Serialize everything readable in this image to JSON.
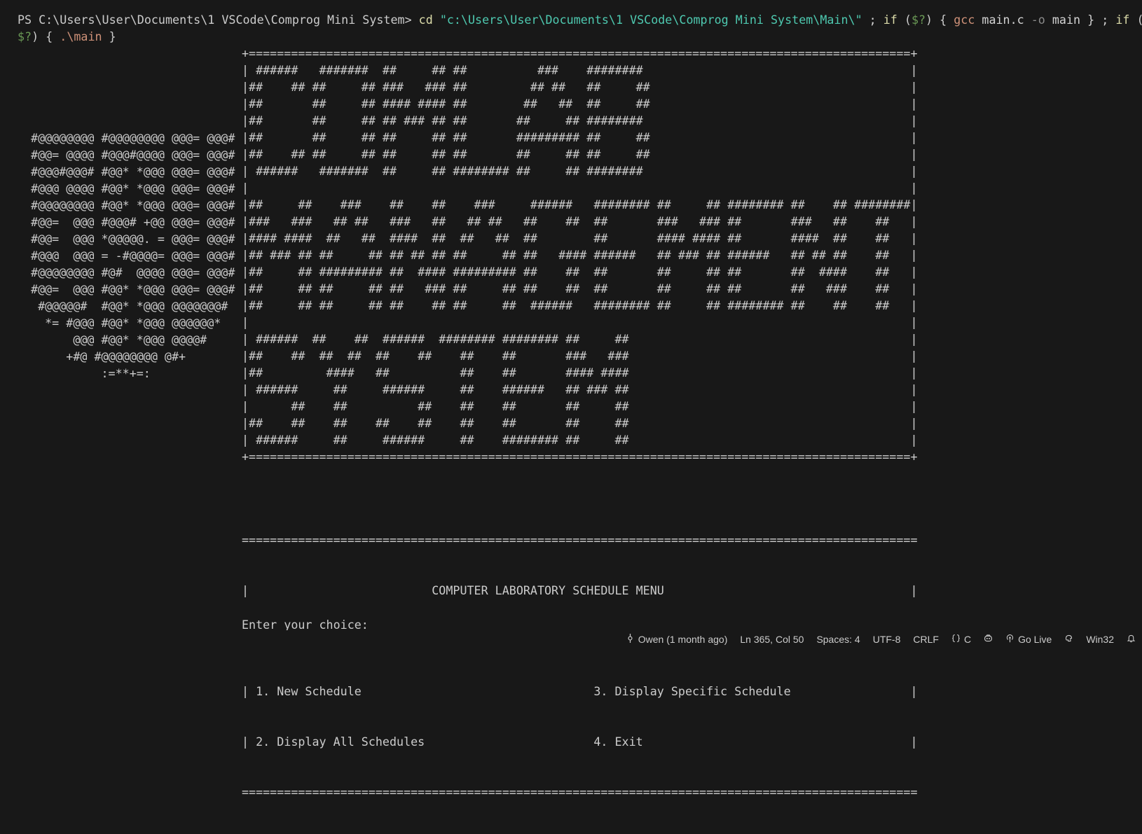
{
  "terminal": {
    "command": {
      "ps": "PS ",
      "cwd": "C:\\Users\\User\\Documents\\1 VSCode\\Comprog Mini System>",
      "cd": "cd",
      "path": "\"c:\\Users\\User\\Documents\\1 VSCode\\Comprog Mini System\\Main\\\"",
      "sep1": " ; ",
      "if1": "if",
      "open1": " (",
      "status1": "$?",
      "close1": ") { ",
      "gcc": "gcc",
      "file": " main.c ",
      "flag": "-o",
      "out": " main } ; ",
      "if2": "if",
      "open2": " (",
      "status2": "$?",
      "close2": ") { ",
      "run": ".\\main",
      "end": " }"
    },
    "logo_art": " #@@@@@@@@ #@@@@@@@@ @@@= @@@#\n #@@= @@@@ #@@@#@@@@ @@@= @@@#\n #@@@#@@@# #@@* *@@@ @@@= @@@#\n #@@@ @@@@ #@@* *@@@ @@@= @@@#\n #@@@@@@@@ #@@* *@@@ @@@= @@@#\n #@@=  @@@ #@@@# +@@ @@@= @@@#\n #@@=  @@@ *@@@@@. = @@@= @@@#\n #@@@  @@@ = -#@@@@= @@@= @@@#\n #@@@@@@@@ #@#  @@@@ @@@= @@@#\n #@@=  @@@ #@@* *@@@ @@@= @@@#\n  #@@@@@#  #@@* *@@@ @@@@@@@#\n   *= #@@@ #@@* *@@@ @@@@@@*\n       @@@ #@@* *@@@ @@@@#\n      +#@ #@@@@@@@@ @#+\n           :=**+=:",
    "banner_art": "+==============================================================================================+\n| ######   #######  ##     ## ##          ###    ########                                      |\n|##    ## ##     ## ###   ### ##         ## ##   ##     ##                                     |\n|##       ##     ## #### #### ##        ##   ##  ##     ##                                     |\n|##       ##     ## ## ### ## ##       ##     ## ########                                      |\n|##       ##     ## ##     ## ##       ######### ##     ##                                     |\n|##    ## ##     ## ##     ## ##       ##     ## ##     ##                                     |\n| ######   #######  ##     ## ######## ##     ## ########                                      |\n|                                                                                              |\n|##     ##    ###    ##    ##    ###     ######   ######## ##     ## ######## ##    ## ########|\n|###   ###   ## ##   ###   ##   ## ##   ##    ##  ##       ###   ### ##       ###   ##    ##   |\n|#### ####  ##   ##  ####  ##  ##   ##  ##        ##       #### #### ##       ####  ##    ##   |\n|## ### ## ##     ## ## ## ## ##     ## ##   #### ######   ## ### ## ######   ## ## ##    ##   |\n|##     ## ######### ##  #### ######### ##    ##  ##       ##     ## ##       ##  ####    ##   |\n|##     ## ##     ## ##   ### ##     ## ##    ##  ##       ##     ## ##       ##   ###    ##   |\n|##     ## ##     ## ##    ## ##     ##  ######   ######## ##     ## ######## ##    ##    ##   |\n|                                                                                              |\n| ######  ##    ##  ######  ######## ######## ##     ##                                        |\n|##    ##  ##  ##  ##    ##    ##    ##       ###   ###                                        |\n|##         ####   ##          ##    ##       #### ####                                        |\n| ######     ##     ######     ##    ######   ## ### ##                                        |\n|      ##    ##          ##    ##    ##       ##     ##                                        |\n|##    ##    ##    ##    ##    ##    ##       ##     ##                                        |\n| ######     ##     ######     ##    ######## ##     ##                                        |\n+==============================================================================================+",
    "menu": {
      "top_rule": "================================================================================================",
      "title_line": "|                          COMPUTER LABORATORY SCHEDULE MENU                                   |",
      "mid_rule": "================================================================================================",
      "row1": "| 1. New Schedule                                 3. Display Specific Schedule                 |",
      "row2": "| 2. Display All Schedules                        4. Exit                                      |",
      "bottom_rule": "================================================================================================"
    },
    "prompt": "Enter your choice:"
  },
  "statusbar": {
    "blame": "Owen (1 month ago)",
    "cursor": "Ln 365, Col 50",
    "indent": "Spaces: 4",
    "encoding": "UTF-8",
    "eol": "CRLF",
    "language": "C",
    "golive": "Go Live",
    "platform": "Win32",
    "icons": [
      "git-commit-icon",
      "braces-icon",
      "copilot-icon",
      "broadcast-icon",
      "gear-brain-icon",
      "bell-icon"
    ]
  }
}
